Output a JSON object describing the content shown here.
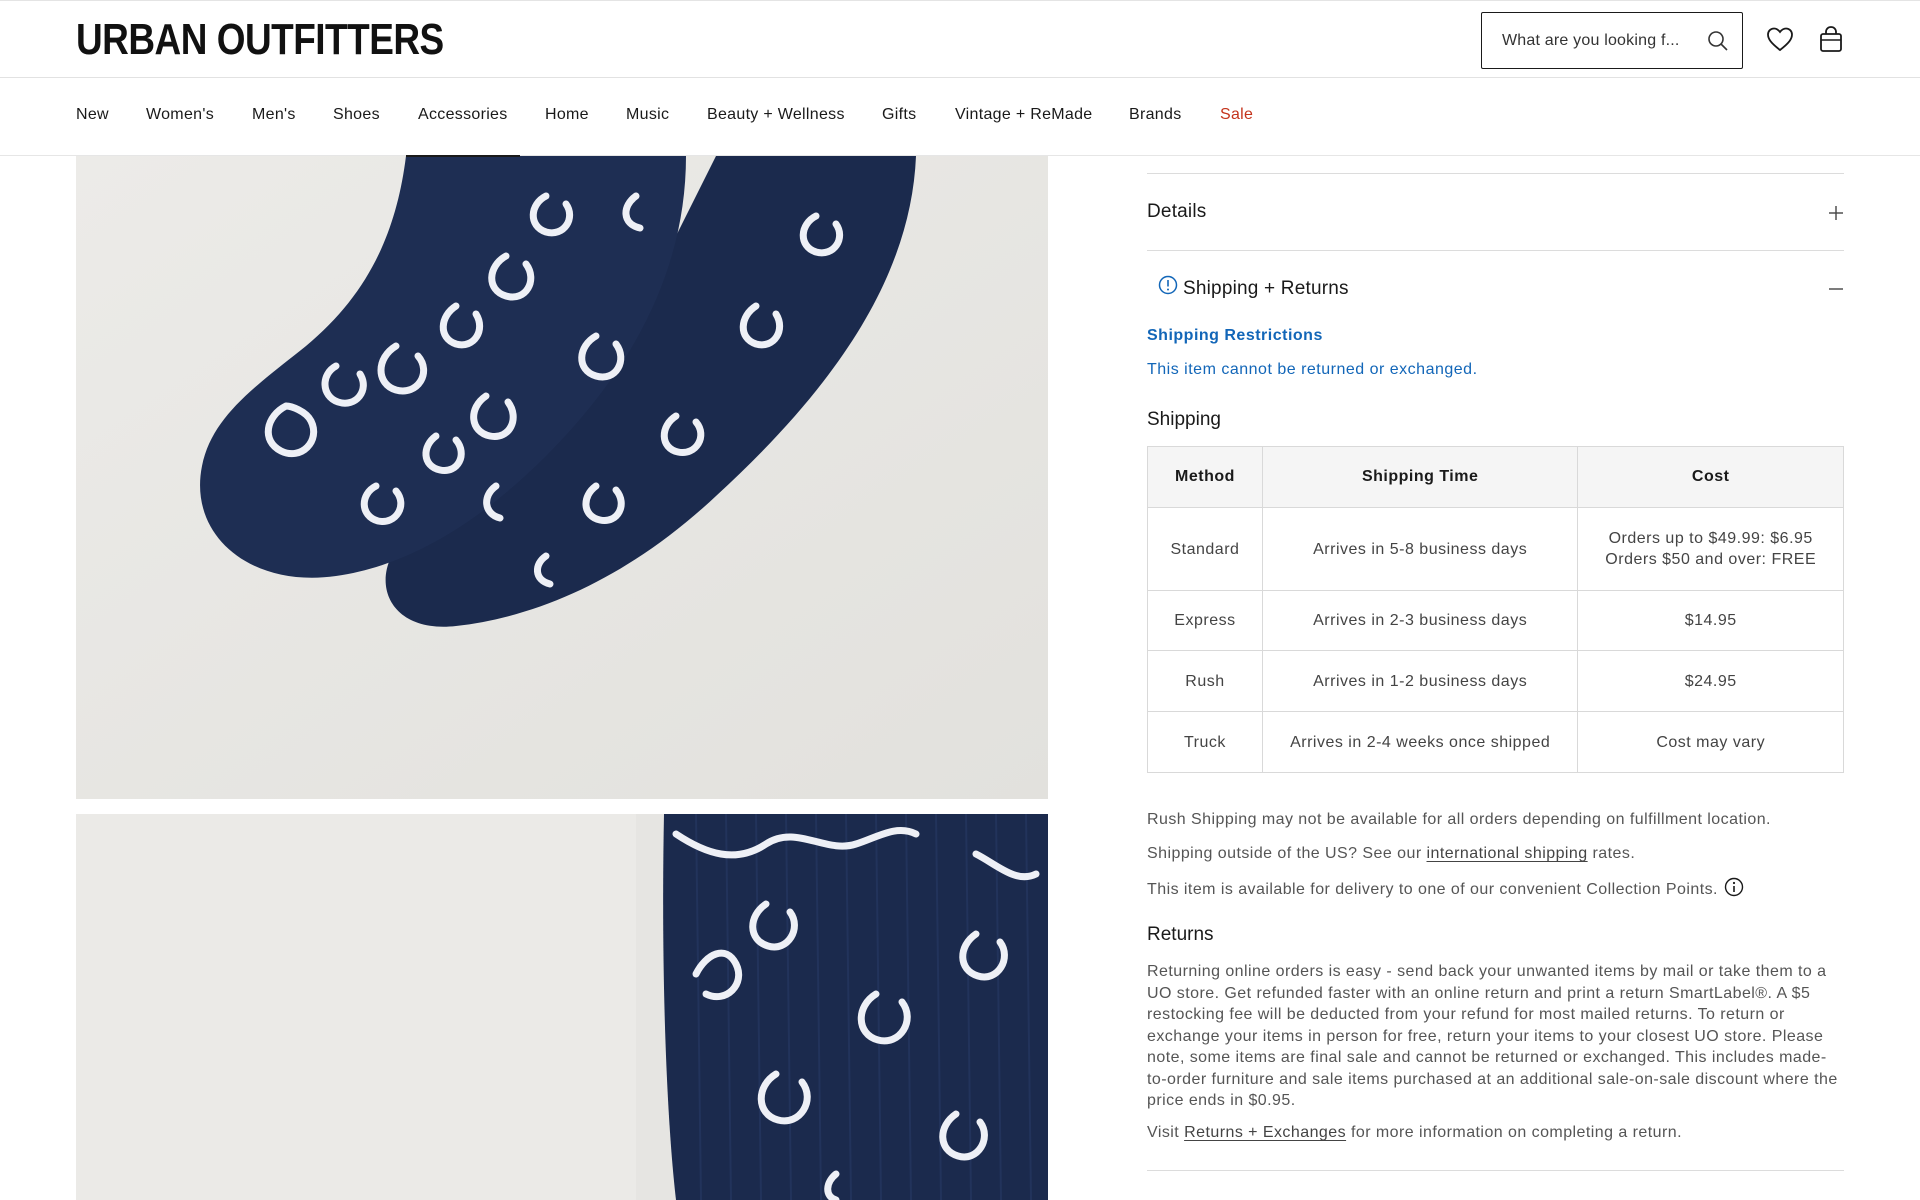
{
  "header": {
    "logo": "URBAN OUTFITTERS",
    "search_placeholder": "What are you looking f...",
    "icons": [
      "search-icon",
      "heart-icon",
      "shopping-bag-icon"
    ]
  },
  "nav": {
    "items": [
      {
        "label": "New"
      },
      {
        "label": "Women's"
      },
      {
        "label": "Men's"
      },
      {
        "label": "Shoes"
      },
      {
        "label": "Accessories",
        "active": true
      },
      {
        "label": "Home"
      },
      {
        "label": "Music"
      },
      {
        "label": "Beauty + Wellness"
      },
      {
        "label": "Gifts"
      },
      {
        "label": "Vintage + ReMade"
      },
      {
        "label": "Brands"
      },
      {
        "label": "Sale",
        "color": "#c4331b"
      }
    ]
  },
  "product_images": [
    {
      "alt": "navy paisley socks"
    },
    {
      "alt": "navy paisley socks detail"
    }
  ],
  "details": {
    "title": "Details",
    "icon": "plus-icon"
  },
  "shipping_returns": {
    "title": "Shipping + Returns",
    "icon": "alert-circle-icon",
    "collapse_icon": "minus-icon",
    "restrictions_heading": "Shipping Restrictions",
    "restrictions_text": "This item cannot be returned or exchanged.",
    "shipping_heading": "Shipping",
    "table": {
      "headers": [
        "Method",
        "Shipping Time",
        "Cost"
      ],
      "rows": [
        {
          "method": "Standard",
          "time": "Arrives in 5-8 business days",
          "cost_line1": "Orders up to $49.99: $6.95",
          "cost_line2": "Orders $50 and over: FREE"
        },
        {
          "method": "Express",
          "time": "Arrives in 2-3 business days",
          "cost_line1": "$14.95"
        },
        {
          "method": "Rush",
          "time": "Arrives in 1-2 business days",
          "cost_line1": "$24.95"
        },
        {
          "method": "Truck",
          "time": "Arrives in 2-4 weeks once shipped",
          "cost_line1": "Cost may vary"
        }
      ]
    },
    "rush_note": "Rush Shipping may not be available for all orders depending on fulfillment location.",
    "intl_before": "Shipping outside of the US? See our ",
    "intl_link": "international shipping",
    "intl_after": " rates.",
    "collection_note": "This item is available for delivery to one of our convenient Collection Points.",
    "returns_heading": "Returns",
    "returns_text": "Returning online orders is easy - send back your unwanted items by mail or take them to a UO store. Get refunded faster with an online return and print a return SmartLabel®. A $5 restocking fee will be deducted from your refund for most mailed returns. To return or exchange your items in person for free, return your items to your closest UO store. Please note, some items are final sale and cannot be returned or exchanged. This includes made-to-order furniture and sale items purchased at an additional sale-on-sale discount where the price ends in $0.95.",
    "visit_before": "Visit ",
    "visit_link": "Returns + Exchanges",
    "visit_after": " for more information on completing a return."
  },
  "colors": {
    "link_blue": "#1266b8",
    "sale_red": "#c4331b",
    "sock_navy": "#1a2a4e"
  }
}
